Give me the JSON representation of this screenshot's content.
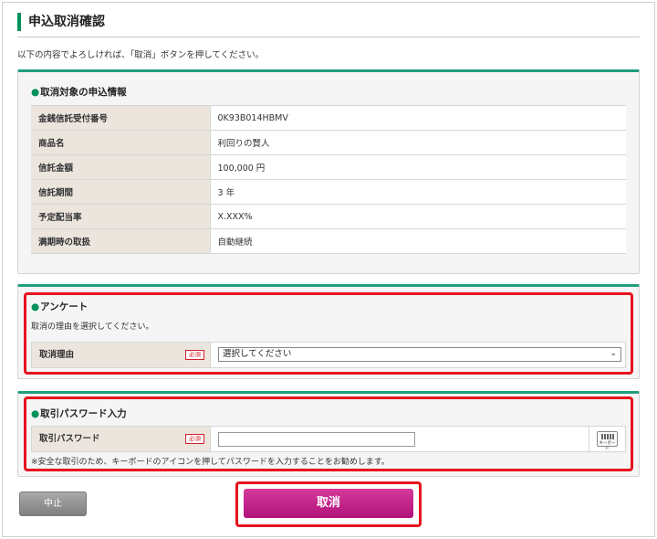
{
  "header": {
    "title": "申込取消確認",
    "intro": "以下の内容でよろしければ、「取消」ボタンを押してください。"
  },
  "target_section": {
    "heading": "取消対象の申込情報",
    "rows": [
      {
        "label": "金銭信託受付番号",
        "value": "0K93B014HBMV"
      },
      {
        "label": "商品名",
        "value": "利回りの賢人"
      },
      {
        "label": "信託金額",
        "value": "100,000 円"
      },
      {
        "label": "信託期間",
        "value": "3 年"
      },
      {
        "label": "予定配当率",
        "value": "X.XXX%"
      },
      {
        "label": "満期時の取扱",
        "value": "自動継続"
      }
    ]
  },
  "survey": {
    "heading": "アンケート",
    "instruction": "取消の理由を選択してください。",
    "field_label": "取消理由",
    "required_badge": "必須",
    "select_value": "選択してください"
  },
  "password": {
    "heading": "取引パスワード入力",
    "field_label": "取引パスワード",
    "required_badge": "必須",
    "input_value": "",
    "keyboard_label": "キーボード",
    "note": "※安全な取引のため、キーボードのアイコンを押してパスワードを入力することをお勧めします。"
  },
  "buttons": {
    "stop_label": "中止",
    "cancel_label": "取消"
  },
  "colors": {
    "accent_green": "#00925a",
    "panel_top": "#1f9e7d",
    "highlight_red": "#e6141e",
    "cancel_button": "#c01f86"
  }
}
